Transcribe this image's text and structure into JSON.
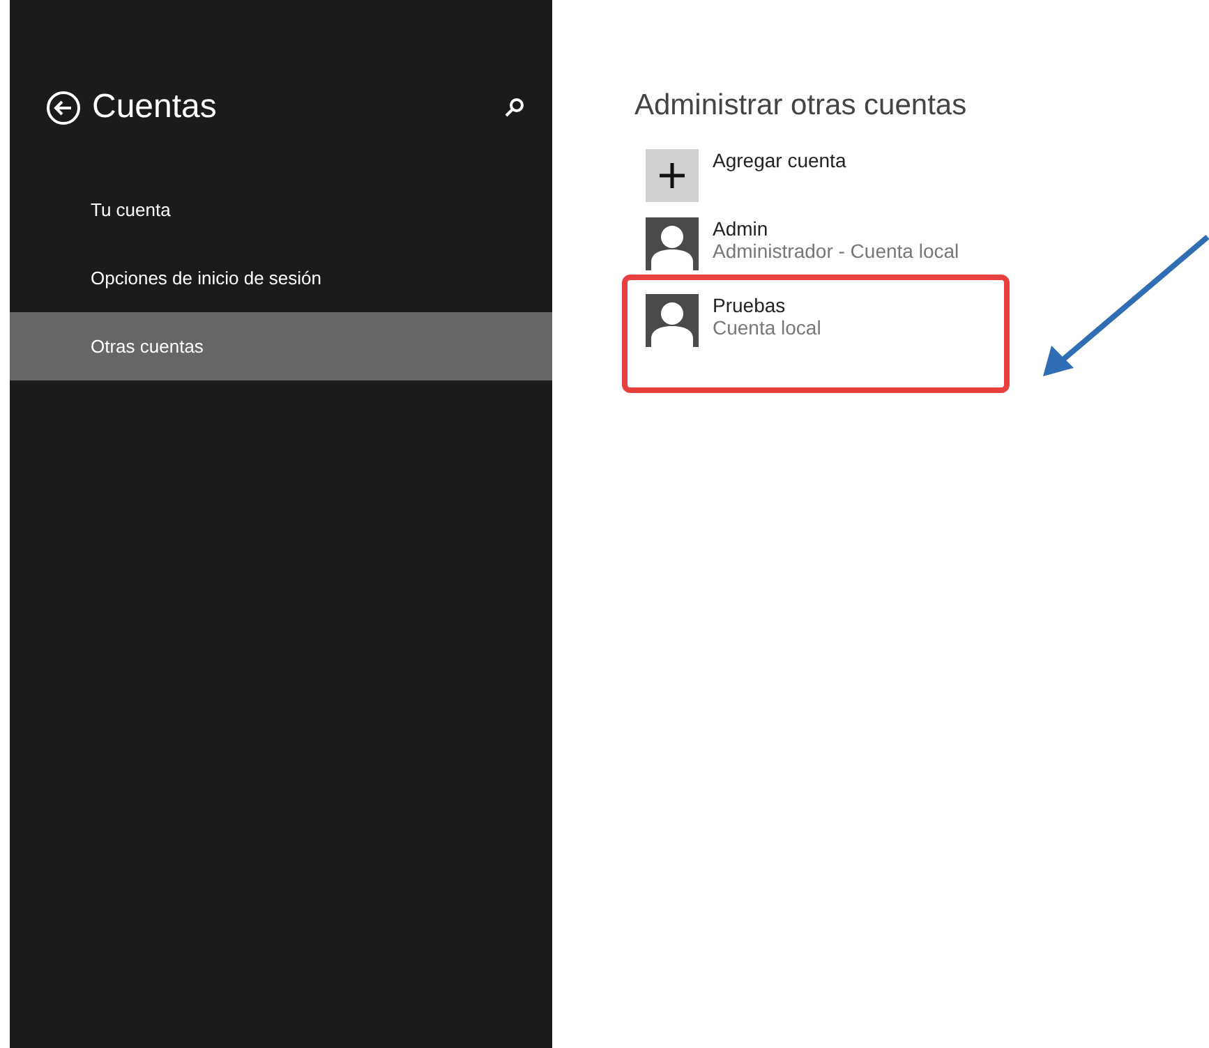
{
  "sidebar": {
    "title": "Cuentas",
    "items": [
      {
        "label": "Tu cuenta",
        "selected": false
      },
      {
        "label": "Opciones de inicio de sesión",
        "selected": false
      },
      {
        "label": "Otras cuentas",
        "selected": true
      }
    ]
  },
  "main": {
    "heading": "Administrar otras cuentas",
    "accounts": [
      {
        "kind": "add",
        "name": "Agregar cuenta",
        "highlighted": false
      },
      {
        "kind": "user",
        "name": "Admin",
        "detail": "Administrador - Cuenta local",
        "highlighted": false
      },
      {
        "kind": "user",
        "name": "Pruebas",
        "detail": "Cuenta local",
        "highlighted": true
      }
    ]
  }
}
